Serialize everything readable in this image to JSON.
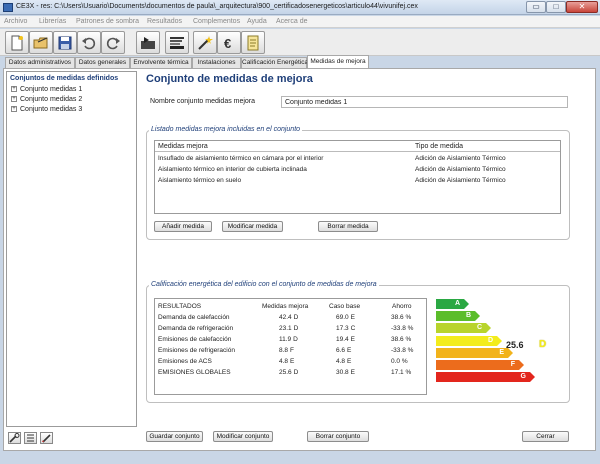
{
  "window": {
    "title": "CE3X - res: C:\\Users\\Usuario\\Documents\\documentos de paula\\_arquitectura\\900_certificadosenergeticos\\articulo44\\vivunifej.cex",
    "min_glyph": "▭",
    "max_glyph": "□",
    "close_glyph": "✕"
  },
  "menu": [
    "Archivo",
    "Librerías",
    "Patrones de sombra",
    "Resultados",
    "Complementos",
    "Ayuda",
    "Acerca de"
  ],
  "tabs": [
    "Datos administrativos",
    "Datos generales",
    "Envolvente térmica",
    "Instalaciones",
    "Calificación Energética",
    "Medidas de mejora"
  ],
  "tree": {
    "title": "Conjuntos de medidas definidos",
    "expander": "+",
    "items": [
      "Conjunto medidas 1",
      "Conjunto medidas 2",
      "Conjunto medidas 3"
    ]
  },
  "main": {
    "title": "Conjunto de medidas de mejora",
    "name_label": "Nombre conjunto medidas mejora",
    "name_value": "Conjunto medidas 1"
  },
  "measures": {
    "legend": "Listado medidas mejora incluidas en el conjunto",
    "col_measure": "Medidas mejora",
    "col_type": "Tipo de medida",
    "rows": [
      {
        "measure": "Insuflado de aislamiento térmico en cámara por el interior",
        "type": "Adición de Aislamiento Térmico"
      },
      {
        "measure": "Aislamiento térmico en interior de cubierta inclinada",
        "type": "Adición de Aislamiento Térmico"
      },
      {
        "measure": "Aislamiento térmico en suelo",
        "type": "Adición de Aislamiento Térmico"
      }
    ],
    "btn_add": "Añadir medida",
    "btn_modify": "Modificar medida",
    "btn_delete": "Borrar medida"
  },
  "rating": {
    "legend": "Calificación energética del edificio con el conjunto de medidas de mejora",
    "headers": [
      "RESULTADOS",
      "Medidas mejora",
      "Caso base",
      "Ahorro"
    ],
    "rows": [
      {
        "label": "Demanda de calefacción",
        "improved": "42.4",
        "improved_class": "D",
        "base": "69.0",
        "base_class": "E",
        "saving": "38.6 %"
      },
      {
        "label": "Demanda de refrigeración",
        "improved": "23.1",
        "improved_class": "D",
        "base": "17.3",
        "base_class": "C",
        "saving": "-33.8 %"
      },
      {
        "label": "Emisiones de calefacción",
        "improved": "11.9",
        "improved_class": "D",
        "base": "19.4",
        "base_class": "E",
        "saving": "38.6 %"
      },
      {
        "label": "Emisiones de refrigeración",
        "improved": "8.8",
        "improved_class": "F",
        "base": "6.6",
        "base_class": "E",
        "saving": "-33.8 %"
      },
      {
        "label": "Emisiones de ACS",
        "improved": "4.8",
        "improved_class": "E",
        "base": "4.8",
        "base_class": "E",
        "saving": "0.0 %"
      },
      {
        "label": "EMISIONES GLOBALES",
        "improved": "25.6",
        "improved_class": "D",
        "base": "30.8",
        "base_class": "E",
        "saving": "17.1 %"
      }
    ],
    "scale": [
      {
        "letter": "A",
        "color": "#2aa843"
      },
      {
        "letter": "B",
        "color": "#5bbd2b"
      },
      {
        "letter": "C",
        "color": "#b8d42c"
      },
      {
        "letter": "D",
        "color": "#f3ec1c"
      },
      {
        "letter": "E",
        "color": "#f2b31b"
      },
      {
        "letter": "F",
        "color": "#ec6c1c"
      },
      {
        "letter": "G",
        "color": "#e3261d"
      }
    ],
    "result_value": "25.6",
    "result_class": "D"
  },
  "footer": {
    "save": "Guardar conjunto",
    "modify": "Modificar conjunto",
    "delete": "Borrar conjunto",
    "close": "Cerrar"
  }
}
